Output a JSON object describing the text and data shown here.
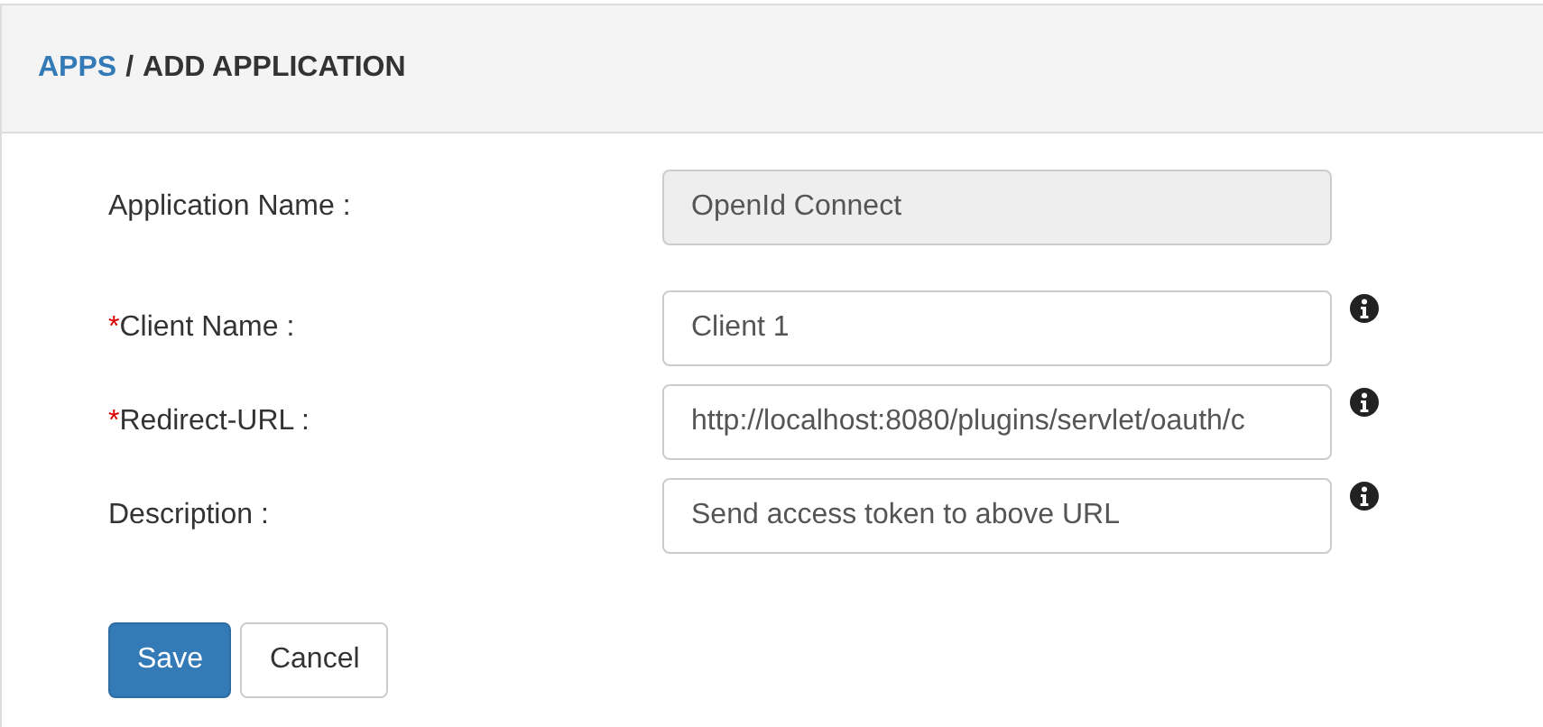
{
  "breadcrumb": {
    "link": "APPS",
    "separator": "/",
    "current": "ADD APPLICATION"
  },
  "fields": [
    {
      "label": "Application Name :",
      "value": "OpenId Connect",
      "disabled": true,
      "info": false
    },
    {
      "label": "Client Name :",
      "required_mark": "*",
      "value": "Client 1",
      "disabled": false,
      "info": true
    },
    {
      "label": "Redirect-URL :",
      "required_mark": "*",
      "value": "http://localhost:8080/plugins/servlet/oauth/c",
      "disabled": false,
      "info": true
    },
    {
      "label": "Description :",
      "value": "Send access token to above URL",
      "disabled": false,
      "info": true
    }
  ],
  "buttons": [
    {
      "label": "Save",
      "kind": "primary"
    },
    {
      "label": "Cancel",
      "kind": "default"
    }
  ]
}
